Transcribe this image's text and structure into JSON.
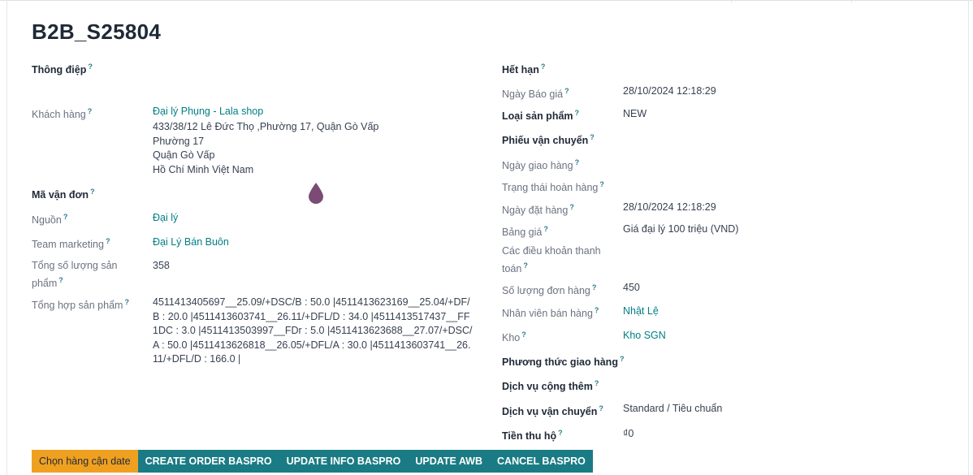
{
  "record_title": "B2B_S25804",
  "left": {
    "thong_diep": "Thông điệp",
    "khach_hang_label": "Khách hàng",
    "khach_hang_value": "Đại lý Phụng - Lala shop",
    "address_lines": [
      "433/38/12 Lê Đức Thọ ,Phường 17, Quận Gò Vấp",
      "Phường 17",
      "Quận Gò Vấp",
      "Hồ Chí Minh Việt Nam"
    ],
    "ma_van_don": "Mã vận đơn",
    "nguon_label": "Nguồn",
    "nguon_value": "Đại lý",
    "team_label": "Team marketing",
    "team_value": "Đại Lý Bán Buôn",
    "tong_sl_label": "Tổng số lượng sản phẩm",
    "tong_sl_value": "358",
    "tong_hop_label": "Tổng hợp sản phẩm",
    "tong_hop_value": "4511413405697__25.09/+DSC/B : 50.0 |4511413623169__25.04/+DF/B : 20.0 |4511413603741__26.11/+DFL/D : 34.0 |4511413517437__FF1DC : 3.0 |4511413503997__FDr : 5.0 |4511413623688__27.07/+DSC/A : 50.0 |4511413626818__26.05/+DFL/A : 30.0 |4511413603741__26.11/+DFL/D : 166.0 |"
  },
  "right": {
    "het_han": "Hết hạn",
    "ngay_bao_gia_label": "Ngày Báo giá",
    "ngay_bao_gia_value": "28/10/2024 12:18:29",
    "loai_sp_label": "Loại sản phẩm",
    "loai_sp_value": "NEW",
    "phieu_vc": "Phiếu vận chuyển",
    "ngay_giao_label": "Ngày giao hàng",
    "trang_thai_label": "Trạng thái hoàn hàng",
    "ngay_dat_label": "Ngày đặt hàng",
    "ngay_dat_value": "28/10/2024 12:18:29",
    "bang_gia_label": "Bảng giá",
    "bang_gia_value": "Giá đại lý 100 triệu (VND)",
    "dieu_khoan_label": "Các điều khoản thanh toán",
    "so_luong_label": "Số lượng đơn hàng",
    "so_luong_value": "450",
    "nhan_vien_label": "Nhân viên bán hàng",
    "nhan_vien_value": "Nhật Lệ",
    "kho_label": "Kho",
    "kho_value": "Kho SGN",
    "phuong_thuc_label": "Phương thức giao hàng",
    "dich_vu_ct_label": "Dịch vụ cộng thêm",
    "dich_vu_vc_label": "Dịch vụ vận chuyển",
    "dich_vu_vc_value": "Standard / Tiêu chuẩn",
    "tien_thu_label": "Tiền thu hộ",
    "tien_thu_value": "₫0"
  },
  "help_mark": "?",
  "buttons": {
    "chon_hang": "Chọn hàng cận date",
    "create_order": "CREATE ORDER BASPRO",
    "update_info": "UPDATE INFO BASPRO",
    "update_awb": "UPDATE AWB",
    "cancel": "CANCEL BASPRO"
  },
  "colors": {
    "link": "#017e84",
    "button_primary": "#1a7b84",
    "button_warning": "#f0a020",
    "drop_icon": "#7b4a75"
  },
  "icons": {
    "cursor_drop": "drop-icon"
  }
}
